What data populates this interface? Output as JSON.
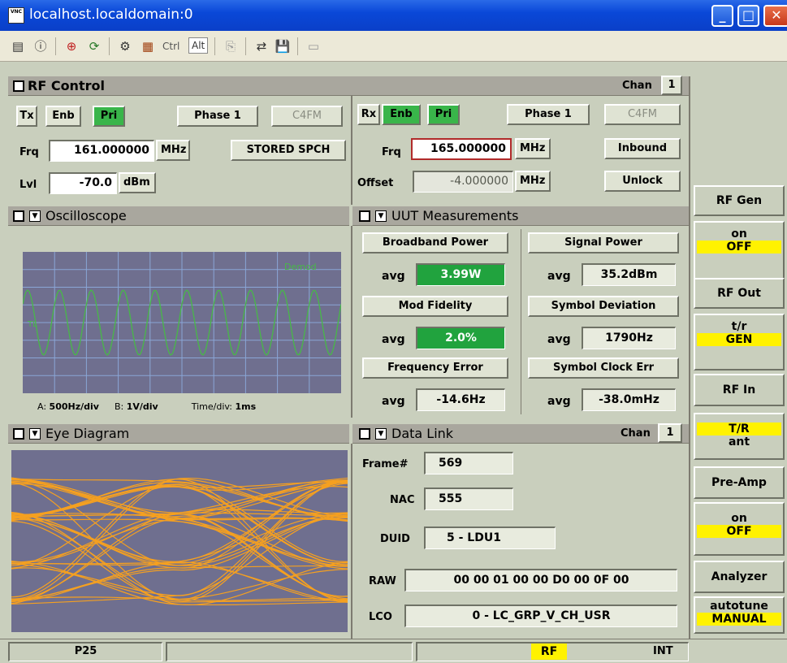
{
  "window": {
    "title": "localhost.localdomain:0",
    "app_icon": "vnc-icon",
    "controls": [
      "minimize",
      "maximize",
      "close"
    ]
  },
  "toolbar": {
    "icons": [
      "options-icon",
      "info-icon",
      "fullscreen-icon",
      "refresh-icon",
      "ctrl-alt-del-icon",
      "send-keys-icon",
      "ctrl-label",
      "alt-label",
      "copy-icon",
      "transfer-icon",
      "save-icon",
      "disconnect-icon"
    ],
    "ctrl": "Ctrl",
    "alt": "Alt"
  },
  "rf_control": {
    "title": "RF Control",
    "chan_label": "Chan",
    "chan_value": "1",
    "tx": {
      "label": "Tx",
      "enb": "Enb",
      "pri": "Pri",
      "phase": "Phase 1",
      "c4fm": "C4FM",
      "frq_label": "Frq",
      "frq_value": "161.000000",
      "frq_unit": "MHz",
      "stored": "STORED SPCH",
      "lvl_label": "Lvl",
      "lvl_value": "-70.0",
      "lvl_unit": "dBm"
    },
    "rx": {
      "label": "Rx",
      "enb": "Enb",
      "pri": "Pri",
      "phase": "Phase 1",
      "c4fm": "C4FM",
      "frq_label": "Frq",
      "frq_value": "165.000000",
      "frq_unit": "MHz",
      "inbound": "Inbound",
      "offset_label": "Offset",
      "offset_value": "-4.000000",
      "offset_unit": "MHz",
      "unlock": "Unlock"
    }
  },
  "oscilloscope": {
    "title": "Oscilloscope",
    "trace_label": "Demod",
    "trig_label": "TL",
    "a_label": "A:",
    "a_value": "500Hz/div",
    "b_label": "B:",
    "b_value": "1V/div",
    "time_label": "Time/div:",
    "time_value": "1ms",
    "cycles": 10
  },
  "uut": {
    "title": "UUT Measurements",
    "items": [
      {
        "name": "Broadband Power",
        "avg": "avg",
        "value": "3.99W",
        "green": true
      },
      {
        "name": "Signal Power",
        "avg": "avg",
        "value": "35.2dBm",
        "green": false
      },
      {
        "name": "Mod Fidelity",
        "avg": "avg",
        "value": "2.0%",
        "green": true
      },
      {
        "name": "Symbol Deviation",
        "avg": "avg",
        "value": "1790Hz",
        "green": false
      },
      {
        "name": "Frequency Error",
        "avg": "avg",
        "value": "-14.6Hz",
        "green": false
      },
      {
        "name": "Symbol Clock Err",
        "avg": "avg",
        "value": "-38.0mHz",
        "green": false
      }
    ]
  },
  "eye": {
    "title": "Eye Diagram"
  },
  "data_link": {
    "title": "Data Link",
    "chan_label": "Chan",
    "chan_value": "1",
    "frame_label": "Frame#",
    "frame_value": "569",
    "nac_label": "NAC",
    "nac_value": "555",
    "duid_label": "DUID",
    "duid_value": "5 - LDU1",
    "raw_label": "RAW",
    "raw_value": "00 00 01 00 00 D0 00 0F 00",
    "lco_label": "LCO",
    "lco_value": "0 - LC_GRP_V_CH_USR"
  },
  "side": {
    "rf_gen": {
      "title": "RF Gen",
      "opt1": "on",
      "opt2": "OFF"
    },
    "rf_out": {
      "title": "RF Out",
      "opt1": "t/r",
      "opt2": "GEN"
    },
    "rf_in": {
      "title": "RF In",
      "opt1": "T/R",
      "opt2": "ant"
    },
    "preamp": {
      "title": "Pre-Amp",
      "opt1": "on",
      "opt2": "OFF"
    },
    "analyzer": {
      "title": "Analyzer",
      "opt1": "autotune",
      "opt2": "MANUAL"
    }
  },
  "status": {
    "mode": "P25",
    "rf": "RF",
    "ref": "INT"
  },
  "colors": {
    "green": "#21a33e",
    "yellow": "#fff200",
    "trace": "#f5a020",
    "scope_bg": "#6f6f8f",
    "scope_line": "#48b848"
  }
}
